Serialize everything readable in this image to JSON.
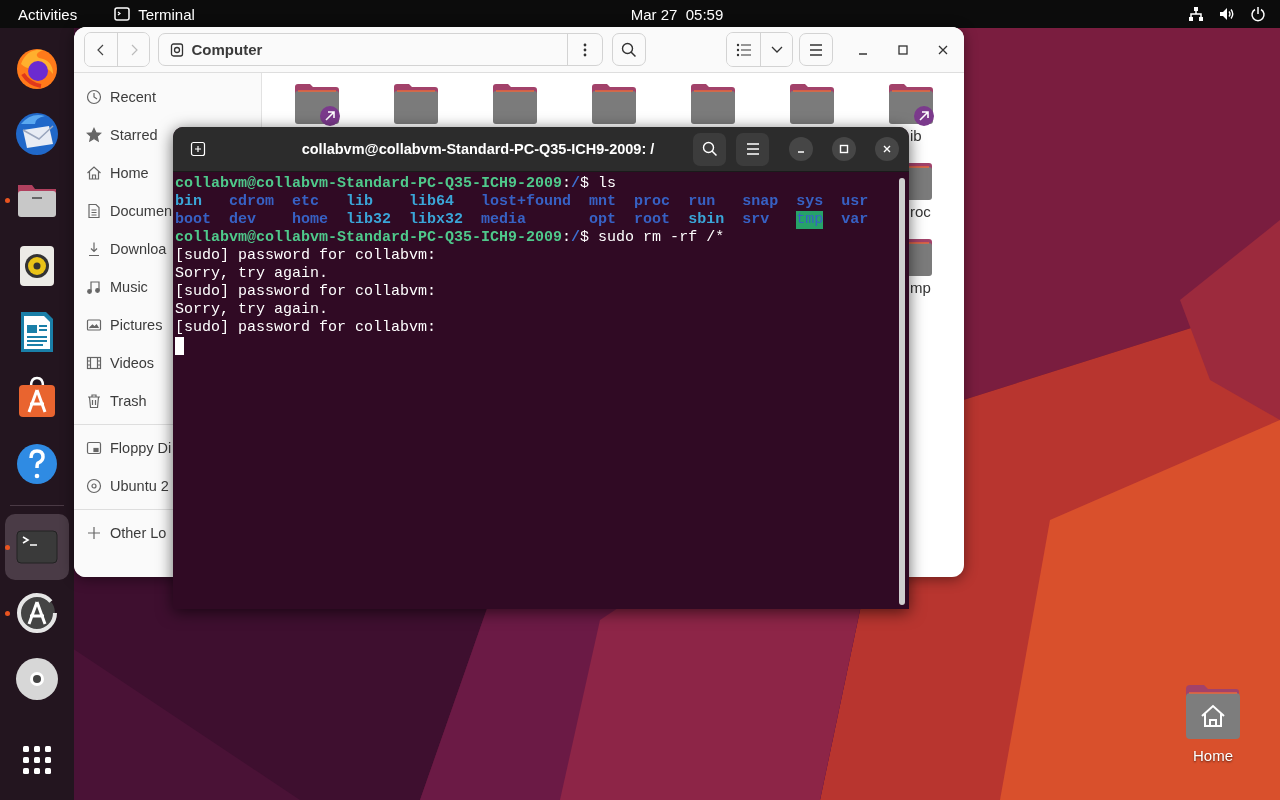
{
  "top_bar": {
    "activities": "Activities",
    "app_name": "Terminal",
    "clock": "Mar 27  05:59"
  },
  "dock": {
    "items": [
      {
        "kind": "browser",
        "running": false,
        "focused": false
      },
      {
        "kind": "mail",
        "running": false,
        "focused": false
      },
      {
        "kind": "files",
        "running": true,
        "focused": false
      },
      {
        "kind": "music",
        "running": false,
        "focused": false
      },
      {
        "kind": "writer",
        "running": false,
        "focused": false
      },
      {
        "kind": "store",
        "running": false,
        "focused": false
      },
      {
        "kind": "help",
        "running": false,
        "focused": false
      },
      {
        "kind": "separator"
      },
      {
        "kind": "terminal",
        "running": true,
        "focused": true
      },
      {
        "kind": "updater",
        "running": true,
        "focused": false
      },
      {
        "kind": "disc",
        "running": false,
        "focused": false
      },
      {
        "kind": "apps",
        "running": false,
        "focused": false
      }
    ]
  },
  "files_window": {
    "nav": [
      {
        "kind": "back",
        "disabled": false
      },
      {
        "kind": "forward",
        "disabled": true
      }
    ],
    "path": "Computer",
    "sidebar": [
      [
        {
          "kind": "recent",
          "label": "Recent"
        },
        {
          "kind": "starred",
          "label": "Starred"
        },
        {
          "kind": "home",
          "label": "Home"
        },
        {
          "kind": "documents",
          "label": "Documen"
        },
        {
          "kind": "downloads",
          "label": "Downloa"
        },
        {
          "kind": "music",
          "label": "Music"
        },
        {
          "kind": "pictures",
          "label": "Pictures"
        },
        {
          "kind": "videos",
          "label": "Videos"
        },
        {
          "kind": "trash",
          "label": "Trash"
        }
      ],
      [
        {
          "kind": "floppy",
          "label": "Floppy Di"
        },
        {
          "kind": "disc",
          "label": "Ubuntu 2"
        }
      ],
      [
        {
          "kind": "other",
          "label": "Other Lo"
        }
      ]
    ],
    "rows": [
      [
        {
          "kind": "link"
        },
        {
          "kind": "folder"
        },
        {
          "kind": "folder"
        },
        {
          "kind": "folder"
        },
        {
          "kind": "folder"
        },
        {
          "kind": "folder"
        },
        {
          "kind": "link",
          "label": "ib"
        }
      ],
      [
        {
          "kind": "folder",
          "label": "roc"
        }
      ],
      [
        {
          "kind": "folder",
          "label": "mp"
        }
      ]
    ]
  },
  "terminal": {
    "title": "collabvm@collabvm-Standard-PC-Q35-ICH9-2009: /",
    "lines": [
      {
        "kind": "prompt",
        "segments": [
          {
            "kind": "user",
            "text": "collabvm@collabvm-Standard-PC-Q35-ICH9-2009"
          },
          {
            "kind": "plain",
            "text": ":"
          },
          {
            "kind": "path",
            "text": "/"
          },
          {
            "kind": "plain",
            "text": "$ ls"
          }
        ]
      },
      {
        "kind": "listing",
        "entries": [
          {
            "name": "bin",
            "kind": "link"
          },
          {
            "name": "cdrom",
            "kind": "dir"
          },
          {
            "name": "etc",
            "kind": "dir"
          },
          {
            "name": "lib",
            "kind": "link"
          },
          {
            "name": "lib64",
            "kind": "link"
          },
          {
            "name": "lost+found",
            "kind": "dir"
          },
          {
            "name": "mnt",
            "kind": "dir"
          },
          {
            "name": "proc",
            "kind": "dir"
          },
          {
            "name": "run",
            "kind": "dir"
          },
          {
            "name": "snap",
            "kind": "dir"
          },
          {
            "name": "sys",
            "kind": "dir"
          },
          {
            "name": "usr",
            "kind": "dir"
          },
          {
            "name": "boot",
            "kind": "dir"
          },
          {
            "name": "dev",
            "kind": "dir"
          },
          {
            "name": "home",
            "kind": "dir"
          },
          {
            "name": "lib32",
            "kind": "link"
          },
          {
            "name": "libx32",
            "kind": "link"
          },
          {
            "name": "media",
            "kind": "dir"
          },
          {
            "name": "opt",
            "kind": "dir"
          },
          {
            "name": "root",
            "kind": "dir"
          },
          {
            "name": "sbin",
            "kind": "link"
          },
          {
            "name": "srv",
            "kind": "dir"
          },
          {
            "name": "tmp",
            "kind": "sticky"
          },
          {
            "name": "var",
            "kind": "dir"
          }
        ]
      },
      {
        "kind": "prompt",
        "segments": [
          {
            "kind": "user",
            "text": "collabvm@collabvm-Standard-PC-Q35-ICH9-2009"
          },
          {
            "kind": "plain",
            "text": ":"
          },
          {
            "kind": "path",
            "text": "/"
          },
          {
            "kind": "plain",
            "text": "$ sudo rm -rf /*"
          }
        ]
      },
      {
        "kind": "output",
        "text": "[sudo] password for collabvm:"
      },
      {
        "kind": "output",
        "text": "Sorry, try again."
      },
      {
        "kind": "output",
        "text": "[sudo] password for collabvm:"
      },
      {
        "kind": "output",
        "text": "Sorry, try again."
      },
      {
        "kind": "output",
        "text": "[sudo] password for collabvm:"
      }
    ],
    "cursor": true
  },
  "desktop_icons": [
    {
      "kind": "home-folder",
      "label": "Home"
    }
  ]
}
